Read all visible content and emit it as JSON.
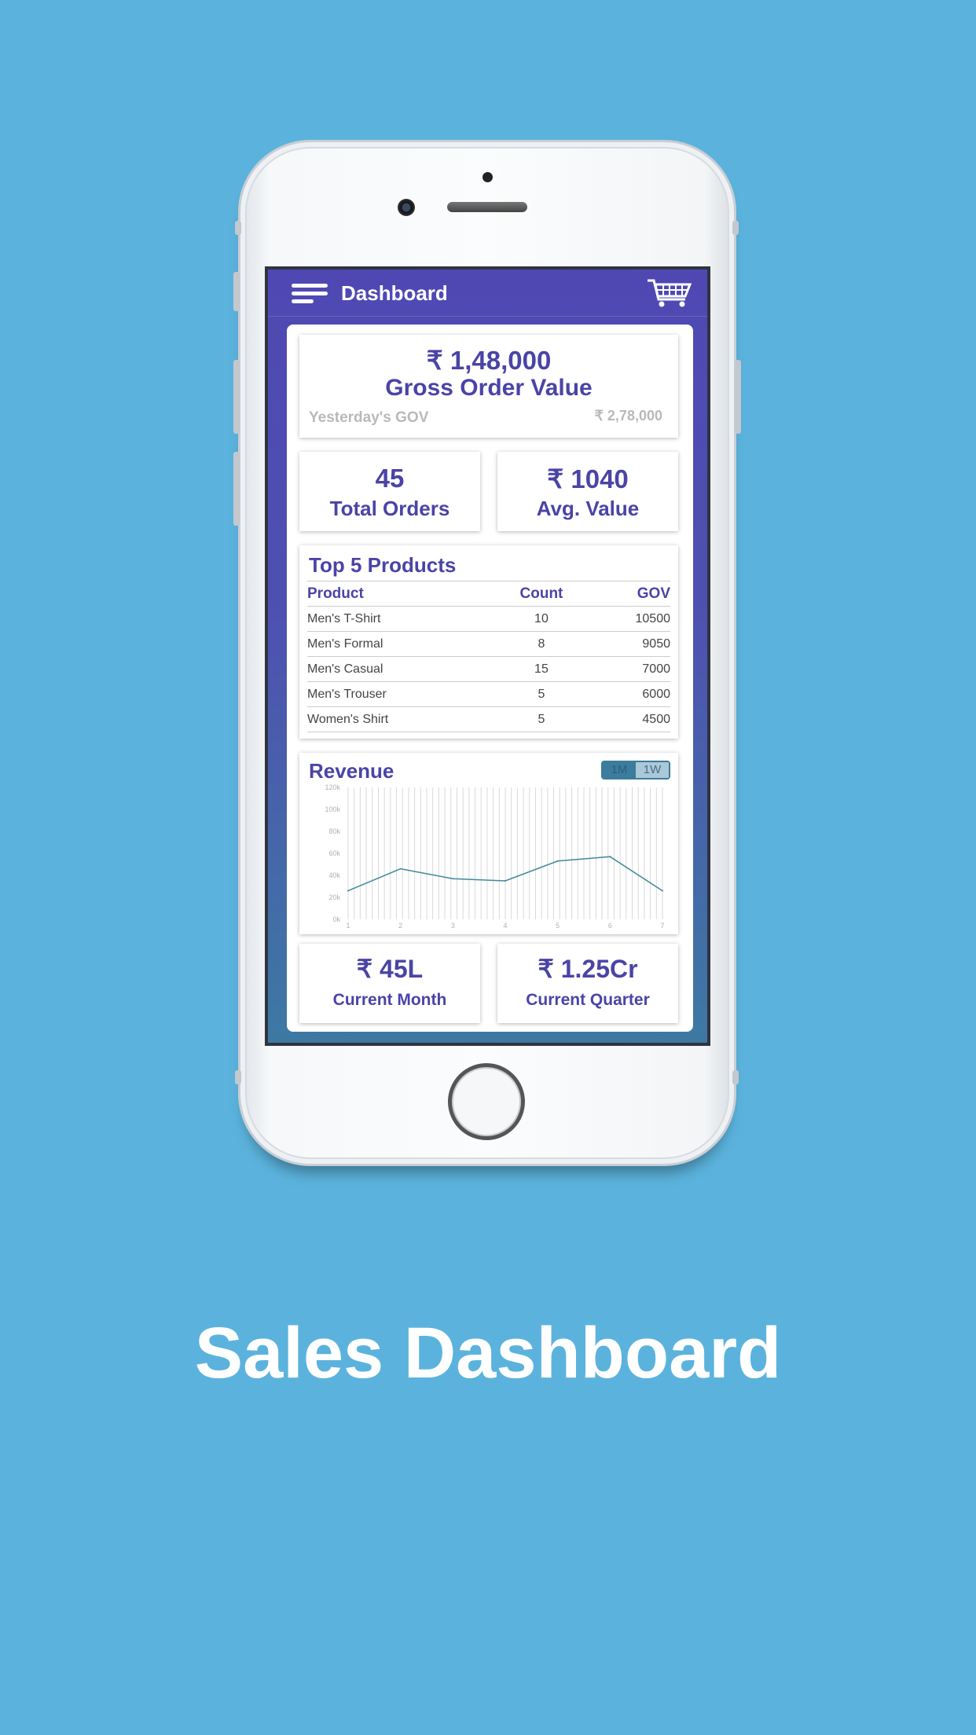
{
  "app": {
    "title": "Dashboard"
  },
  "gov": {
    "amount": "₹ 1,48,000",
    "label": "Gross Order Value",
    "yesterday_label": "Yesterday's GOV",
    "yesterday_value": "₹ 2,78,000"
  },
  "stats": [
    {
      "value": "45",
      "label": "Total Orders"
    },
    {
      "value": "₹ 1040",
      "label": "Avg. Value"
    }
  ],
  "products": {
    "title": "Top 5 Products",
    "headers": [
      "Product",
      "Count",
      "GOV"
    ],
    "rows": [
      [
        "Men's T-Shirt",
        "10",
        "10500"
      ],
      [
        "Men's Formal",
        "8",
        "9050"
      ],
      [
        "Men's Casual",
        "15",
        "7000"
      ],
      [
        "Men's Trouser",
        "5",
        "6000"
      ],
      [
        "Women's Shirt",
        "5",
        "4500"
      ]
    ]
  },
  "revenue": {
    "title": "Revenue",
    "toggle": [
      "1M",
      "1W"
    ],
    "line_color": "#3f8a9a"
  },
  "chart_data": {
    "type": "line",
    "title": "Revenue",
    "x": [
      1,
      2,
      3,
      4,
      5,
      6,
      7
    ],
    "y_ticks": [
      "0k",
      "20k",
      "40k",
      "60k",
      "80k",
      "100k",
      "120k"
    ],
    "ylim": [
      0,
      120000
    ],
    "series": [
      {
        "values": [
          26000,
          46000,
          37000,
          35000,
          53000,
          57000,
          26000
        ]
      }
    ]
  },
  "bottom": [
    {
      "value": "₹ 45L",
      "label": "Current Month"
    },
    {
      "value": "₹ 1.25Cr",
      "label": "Current Quarter"
    }
  ],
  "caption": "Sales Dashboard",
  "colors": {
    "background": "#5bb3dd",
    "accent": "#4a44a6",
    "header": "#4f48b3"
  }
}
